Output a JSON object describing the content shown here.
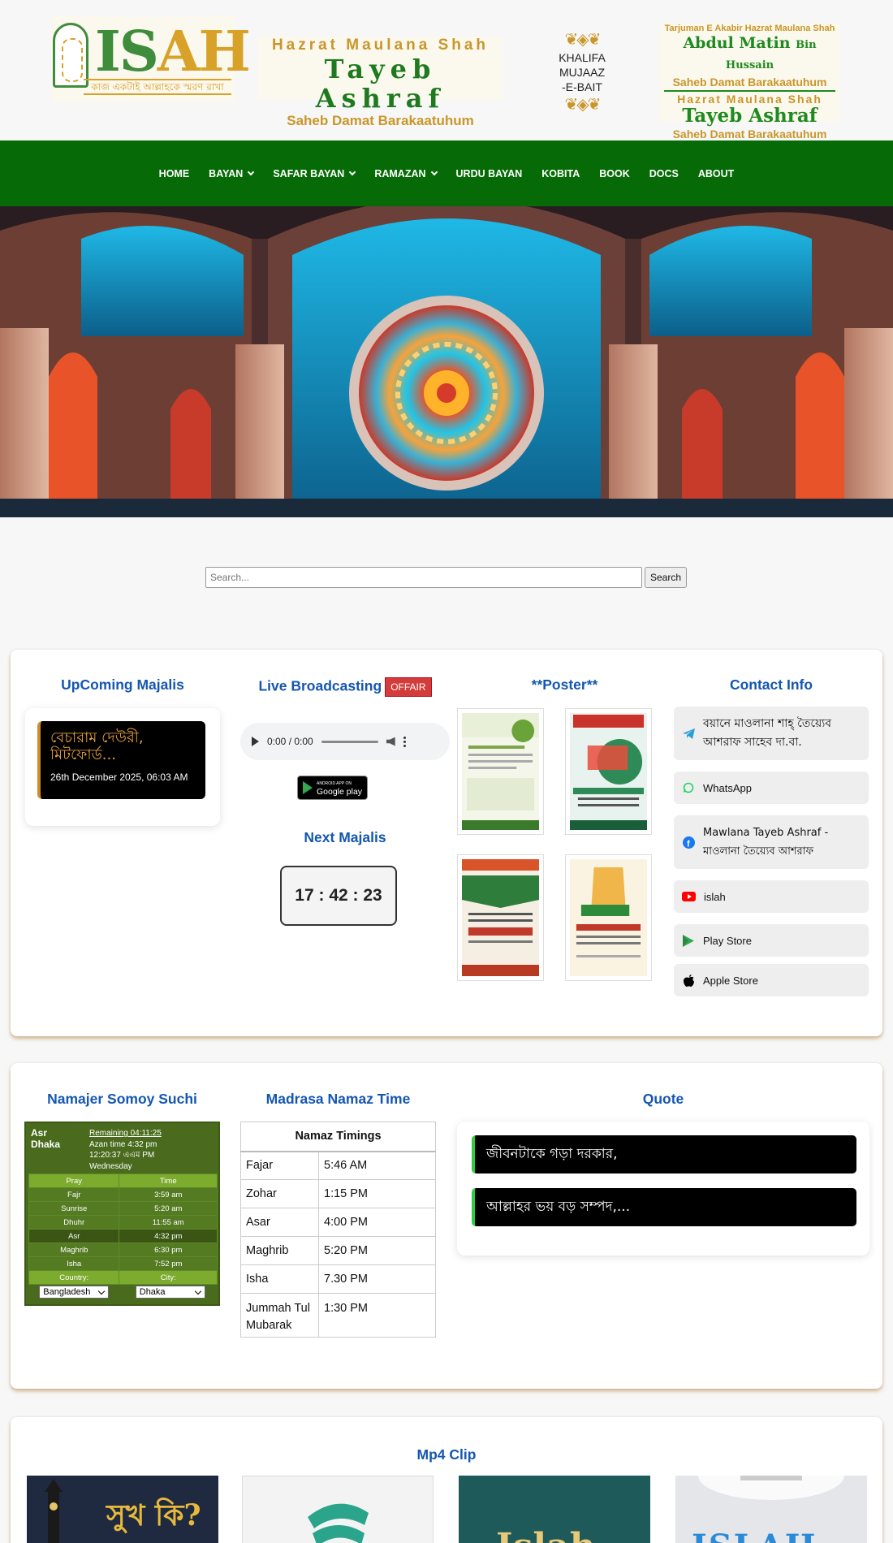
{
  "header": {
    "logo": {
      "text_left": "IS",
      "text_right": "AH",
      "tagline": "কাজ একটাই আল্লাহকে স্মরণ রাখা"
    },
    "title_box": {
      "line1": "Hazrat Maulana Shah",
      "line2": "Tayeb Ashraf",
      "line3": "Saheb Damat Barakaatuhum"
    },
    "khalifa": {
      "line1": "KHALIFA",
      "line2": "MUJAAZ",
      "line3": "-E-BAIT"
    },
    "right_box": {
      "line1": "Tarjuman E Akabir Hazrat Maulana Shah",
      "line2": "Abdul Matin",
      "line2_small": "Bin Hussain",
      "line3": "Saheb Damat Barakaatuhum",
      "line4": "Hazrat Maulana Shah",
      "line5": "Tayeb Ashraf",
      "line6": "Saheb Damat Barakaatuhum"
    }
  },
  "nav": {
    "items": [
      {
        "label": "HOME",
        "dropdown": false
      },
      {
        "label": "BAYAN",
        "dropdown": true
      },
      {
        "label": "SAFAR BAYAN",
        "dropdown": true
      },
      {
        "label": "RAMAZAN",
        "dropdown": true
      },
      {
        "label": "URDU BAYAN",
        "dropdown": false
      },
      {
        "label": "KOBITA",
        "dropdown": false
      },
      {
        "label": "BOOK",
        "dropdown": false
      },
      {
        "label": "DOCS",
        "dropdown": false
      },
      {
        "label": "ABOUT",
        "dropdown": false
      }
    ]
  },
  "search": {
    "placeholder": "Search...",
    "button": "Search"
  },
  "upcoming": {
    "title": "UpComing Majalis",
    "event_title": "বেচারাম দেউরী, মিটফোর্ড...",
    "event_date": "26th December 2025, 06:03 AM"
  },
  "live": {
    "title": "Live Broadcasting",
    "status": "OFFAIR",
    "audio_time": "0:00 / 0:00",
    "gplay_small": "ANDROID APP ON",
    "gplay": "Google play",
    "next_title": "Next Majalis",
    "countdown": "17 : 42 : 23"
  },
  "poster": {
    "title": "**Poster**"
  },
  "contact": {
    "title": "Contact Info",
    "items": [
      {
        "icon": "telegram-icon",
        "label": "বয়ানে মাওলানা শাহ্ তৈয়্যেব আশরাফ সাহেব দা.বা."
      },
      {
        "icon": "whatsapp-icon",
        "label": "WhatsApp"
      },
      {
        "icon": "facebook-icon",
        "label": "Mawlana Tayeb Ashraf - মাওলানা তৈয়্যেব আশরাফ"
      },
      {
        "icon": "youtube-icon",
        "label": "islah"
      },
      {
        "icon": "play-store-icon",
        "label": "Play Store"
      },
      {
        "icon": "apple-icon",
        "label": "Apple Store"
      }
    ]
  },
  "namaz_widget": {
    "title": "Namajer Somoy Suchi",
    "prayer": "Asr",
    "city": "Dhaka",
    "remaining": "Remaining 04:11:25",
    "azan": "Azan time 4:32 pm",
    "clock": "12:20:37 এএম PM",
    "day": "Wednesday",
    "headers": [
      "Pray",
      "Time"
    ],
    "rows": [
      [
        "Fajr",
        "3:59 am"
      ],
      [
        "Sunrise",
        "5:20 am"
      ],
      [
        "Dhuhr",
        "11:55 am"
      ],
      [
        "Asr",
        "4:32 pm"
      ],
      [
        "Maghrib",
        "6:30 pm"
      ],
      [
        "Isha",
        "7:52 pm"
      ]
    ],
    "country_label": "Country:",
    "city_label": "City:",
    "country_value": "Bangladesh",
    "city_value": "Dhaka"
  },
  "madrasa": {
    "title": "Madrasa Namaz Time",
    "header": "Namaz Timings",
    "rows": [
      [
        "Fajar",
        "5:46 AM"
      ],
      [
        "Zohar",
        "1:15 PM"
      ],
      [
        "Asar",
        "4:00 PM"
      ],
      [
        "Maghrib",
        "5:20 PM"
      ],
      [
        "Isha",
        "7.30 PM"
      ],
      [
        "Jummah Tul Mubarak",
        "1:30 PM"
      ]
    ]
  },
  "quote": {
    "title": "Quote",
    "items": [
      "জীবনটাকে গড়া দরকার,",
      "আল্লাহর ভয় বড় সম্পদ,..."
    ]
  },
  "mp4": {
    "title": "Mp4 Clip",
    "clip1_text": "সুখ কি?",
    "clip3_text": "Islah",
    "clip4_text": "ISLAH"
  },
  "colors": {
    "nav_green": "#066b06",
    "title_blue": "#1456b0",
    "gold": "#c9962a",
    "offair_red": "#d43b3b"
  }
}
